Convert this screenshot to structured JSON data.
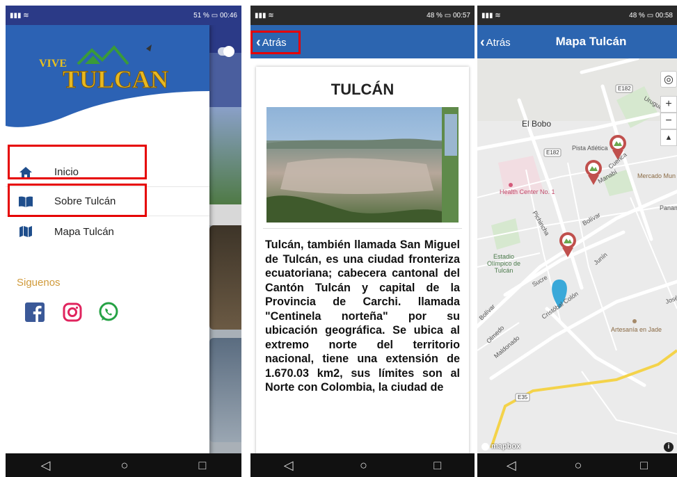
{
  "screen1": {
    "status": {
      "left": "…… ",
      "battery": "51 %",
      "time": "00:46"
    },
    "logo_text": "VIVE TULCAN",
    "menu": [
      {
        "label": "Inicio",
        "icon": "home-icon"
      },
      {
        "label": "Sobre Tulcán",
        "icon": "book-icon"
      },
      {
        "label": "Mapa Tulcán",
        "icon": "map-icon"
      }
    ],
    "follow_label": "Siguenos",
    "social": [
      "facebook-icon",
      "instagram-icon",
      "whatsapp-icon"
    ]
  },
  "screen2": {
    "status": {
      "battery": "48 %",
      "time": "00:57"
    },
    "back_label": "Atrás",
    "title": "TULCÁN",
    "description": "Tulcán, también llamada San Miguel de Tulcán, es una ciudad fronteriza ecuatoriana; cabecera cantonal del Cantón Tulcán y capital de la Provincia de Carchi. llamada \"Centinela norteña\" por su ubicación geográfica. Se ubica al extremo norte del territorio nacional, tiene una extensión de 1.670.03 km2, sus límites son al Norte con Colombia, la ciudad de"
  },
  "screen3": {
    "status": {
      "battery": "48 %",
      "time": "00:58"
    },
    "back_label": "Atrás",
    "title": "Mapa Tulcán",
    "map_labels": {
      "el_bobo": "El Bobo",
      "e182a": "E182",
      "e182b": "E182",
      "pista": "Pista Atlética",
      "uruguay": "Uruguay",
      "mercado": "Mercado Mun",
      "health": "Health Center No. 1",
      "manabi": "Manabí",
      "cuenca": "Cuenca",
      "pichincha": "Pichincha",
      "bolivar1": "Bolívar",
      "panam": "Panam",
      "estadio": "Estadio Olímpico de Tulcán",
      "sucre": "Sucre",
      "junin": "Junín",
      "cristobal": "Cristóbal Colón",
      "bolivar2": "Bolívar",
      "olmedo": "Olmedo",
      "maldonado": "Maldonado",
      "artesania": "Artesanía en Jade",
      "jose": "José",
      "e35": "E35",
      "mapbox": "mapbox"
    }
  }
}
